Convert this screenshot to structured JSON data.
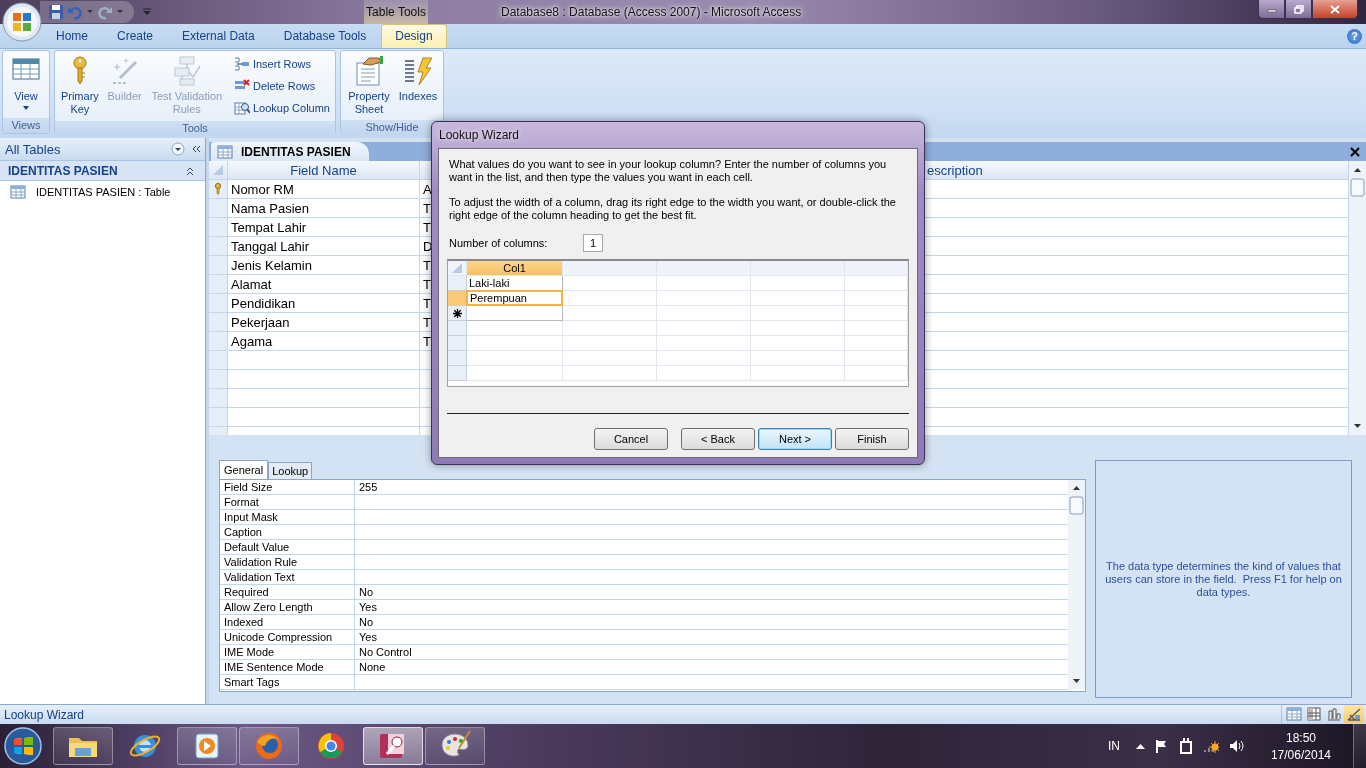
{
  "title_bar": {
    "title": "Database8 : Database (Access 2007) - Microsoft Access",
    "contextual_group": "Table Tools"
  },
  "ribbon_tabs": [
    {
      "label": "Home",
      "selected": false
    },
    {
      "label": "Create",
      "selected": false
    },
    {
      "label": "External Data",
      "selected": false
    },
    {
      "label": "Database Tools",
      "selected": false
    },
    {
      "label": "Design",
      "selected": true
    }
  ],
  "help": "?",
  "ribbon_groups": [
    {
      "label": "Views",
      "controls": [
        {
          "kind": "large",
          "label": "View",
          "dropdown": true,
          "disabled": false
        }
      ]
    },
    {
      "label": "Tools",
      "controls": [
        {
          "kind": "large",
          "label": "Primary Key",
          "dropdown": false,
          "disabled": false
        },
        {
          "kind": "large",
          "label": "Builder",
          "dropdown": false,
          "disabled": true
        },
        {
          "kind": "large",
          "label": "Test Validation Rules",
          "dropdown": false,
          "disabled": true
        },
        {
          "kind": "stack",
          "items": [
            {
              "label": "Insert Rows",
              "disabled": false
            },
            {
              "label": "Delete Rows",
              "disabled": false
            },
            {
              "label": "Lookup Column",
              "disabled": false
            }
          ]
        }
      ]
    },
    {
      "label": "Show/Hide",
      "controls": [
        {
          "kind": "large",
          "label": "Property Sheet",
          "dropdown": false,
          "disabled": false
        },
        {
          "kind": "large",
          "label": "Indexes",
          "dropdown": false,
          "disabled": false
        }
      ]
    }
  ],
  "navigation_pane": {
    "header": "All Tables",
    "groups": [
      {
        "label": "IDENTITAS PASIEN",
        "expanded": true,
        "items": [
          {
            "label": "IDENTITAS PASIEN : Table"
          }
        ]
      }
    ]
  },
  "document_tab": {
    "label": "IDENTITAS PASIEN"
  },
  "design_grid": {
    "field_name_heading": "Field Name",
    "column_3_heading": "escription",
    "rows": [
      {
        "field_name": "Nomor RM",
        "column_2": "A",
        "primary_key": true
      },
      {
        "field_name": "Nama Pasien",
        "column_2": "T",
        "primary_key": false
      },
      {
        "field_name": "Tempat Lahir",
        "column_2": "T",
        "primary_key": false
      },
      {
        "field_name": "Tanggal Lahir",
        "column_2": "D",
        "primary_key": false
      },
      {
        "field_name": "Jenis Kelamin",
        "column_2": "T",
        "primary_key": false
      },
      {
        "field_name": "Alamat",
        "column_2": "T",
        "primary_key": false
      },
      {
        "field_name": "Pendidikan",
        "column_2": "T",
        "primary_key": false
      },
      {
        "field_name": "Pekerjaan",
        "column_2": "T",
        "primary_key": false
      },
      {
        "field_name": "Agama",
        "column_2": "T",
        "primary_key": false
      }
    ]
  },
  "field_properties": {
    "tabs": [
      {
        "label": "General",
        "selected": true
      },
      {
        "label": "Lookup",
        "selected": false
      }
    ],
    "rows": [
      {
        "name": "Field Size",
        "value": "255"
      },
      {
        "name": "Format"
      },
      {
        "name": "Input Mask"
      },
      {
        "name": "Caption"
      },
      {
        "name": "Default Value"
      },
      {
        "name": "Validation Rule"
      },
      {
        "name": "Validation Text"
      },
      {
        "name": "Required",
        "value": "No"
      },
      {
        "name": "Allow Zero Length",
        "value": "Yes"
      },
      {
        "name": "Indexed",
        "value": "No"
      },
      {
        "name": "Unicode Compression",
        "value": "Yes"
      },
      {
        "name": "IME Mode",
        "value": "No Control"
      },
      {
        "name": "IME Sentence Mode",
        "value": "None"
      },
      {
        "name": "Smart Tags"
      }
    ],
    "help_text": "The data type determines the kind of values that users can store in the field.  Press F1 for help on data types."
  },
  "lookup_wizard": {
    "title": "Lookup Wizard",
    "instructions": [
      "What values do you want to see in your lookup column? Enter the number of columns you want in the list, and then type the values you want in each cell.",
      "To adjust the width of a column, drag its right edge to the width you want, or double-click the right edge of the column heading to get the best fit."
    ],
    "columns_label": "Number of columns:",
    "columns_value": "1",
    "column_heading": "Col1",
    "rows": [
      {
        "value": "Laki-laki",
        "selected": false
      },
      {
        "value": "Perempuan",
        "selected": true
      }
    ],
    "buttons": [
      {
        "label": "Cancel",
        "default": false
      },
      {
        "label": "< Back",
        "default": false
      },
      {
        "label": "Next >",
        "default": true
      },
      {
        "label": "Finish",
        "default": false
      }
    ]
  },
  "status_bar": {
    "text": "Lookup Wizard",
    "views": [
      {
        "selected": false
      },
      {
        "selected": false
      },
      {
        "selected": false
      },
      {
        "selected": true
      }
    ]
  },
  "taskbar": {
    "apps": [
      {
        "running": true,
        "active": false
      },
      {
        "running": false,
        "active": false
      },
      {
        "running": true,
        "active": false
      },
      {
        "running": true,
        "active": false
      },
      {
        "running": false,
        "active": false
      },
      {
        "running": true,
        "active": true
      },
      {
        "running": true,
        "active": false
      }
    ],
    "language": "IN",
    "time": "18:50",
    "date": "17/06/2014"
  }
}
